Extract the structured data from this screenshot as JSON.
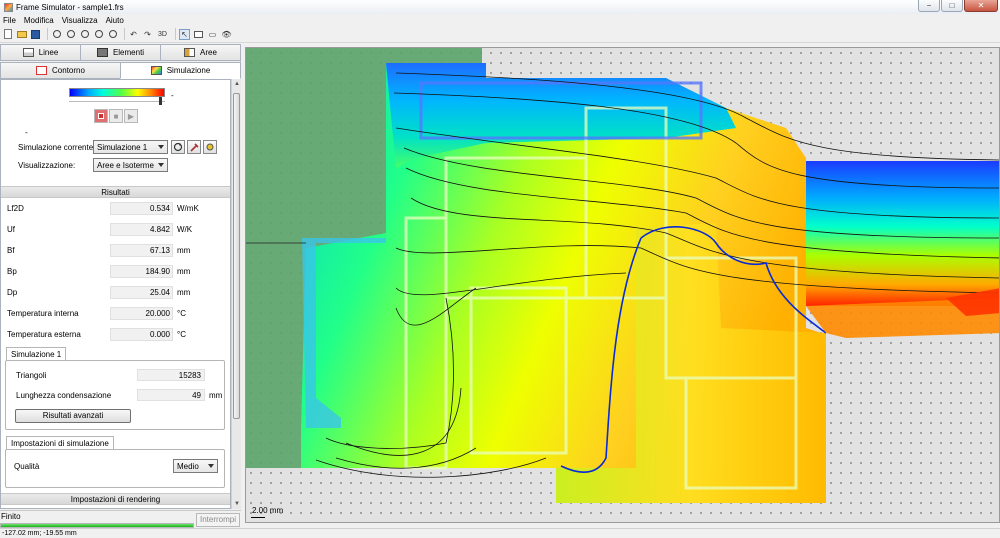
{
  "window": {
    "title": "Frame Simulator - sample1.frs",
    "min": "−",
    "max": "□",
    "close": "✕"
  },
  "menu": [
    "File",
    "Modifica",
    "Visualizza",
    "Aiuto"
  ],
  "toolbar": {
    "view3d_label": "3D",
    "undo": "↶",
    "redo": "↷",
    "select": "↖",
    "eye": "👁",
    "comment": "▭"
  },
  "tabs": {
    "row1": [
      {
        "label": "Linee",
        "icon": "lines-icon"
      },
      {
        "label": "Elementi",
        "icon": "elements-icon"
      },
      {
        "label": "Aree",
        "icon": "areas-icon"
      }
    ],
    "row2": [
      {
        "label": "Contorno",
        "icon": "contour-icon"
      },
      {
        "label": "Simulazione",
        "icon": "simulation-icon"
      }
    ],
    "active": "Simulazione"
  },
  "legend": {
    "min_label": "-",
    "max_label": "-"
  },
  "controls": {
    "stop": "■",
    "pause": "■",
    "play": "▶"
  },
  "simulation": {
    "current_label": "Simulazione corrente:",
    "current_value": "Simulazione 1",
    "view_label": "Visualizzazione:",
    "view_value": "Aree e Isoterme"
  },
  "results": {
    "title": "Risultati",
    "rows": [
      {
        "label": "Lf2D",
        "value": "0.534",
        "unit": "W/mK"
      },
      {
        "label": "Uf",
        "value": "4.842",
        "unit": "W/K"
      },
      {
        "label": "Bf",
        "value": "67.13",
        "unit": "mm"
      },
      {
        "label": "Bp",
        "value": "184.90",
        "unit": "mm"
      },
      {
        "label": "Dp",
        "value": "25.04",
        "unit": "mm"
      },
      {
        "label": "Temperatura interna",
        "value": "20.000",
        "unit": "°C"
      },
      {
        "label": "Temperatura esterna",
        "value": "0.000",
        "unit": "°C"
      }
    ]
  },
  "sim_group": {
    "tab": "Simulazione 1",
    "triangles_label": "Triangoli",
    "triangles_value": "15283",
    "cond_label": "Lunghezza condensazione",
    "cond_value": "49",
    "cond_unit": "mm",
    "advanced_button": "Risultati avanzati"
  },
  "settings_group": {
    "tab": "Impostazioni di simulazione",
    "quality_label": "Qualità",
    "quality_value": "Medio"
  },
  "rendering_section": "Impostazioni di rendering",
  "status": {
    "text": "Finito",
    "progress": 1.0,
    "stop_button": "Interrompi",
    "coords": "-127.02 mm; -19.55 mm"
  },
  "canvas": {
    "scale_label": "2.00 mm"
  },
  "colors": {
    "cold": "#0000ff",
    "warm": "#ff0000",
    "ok_green": "#1db31d"
  }
}
